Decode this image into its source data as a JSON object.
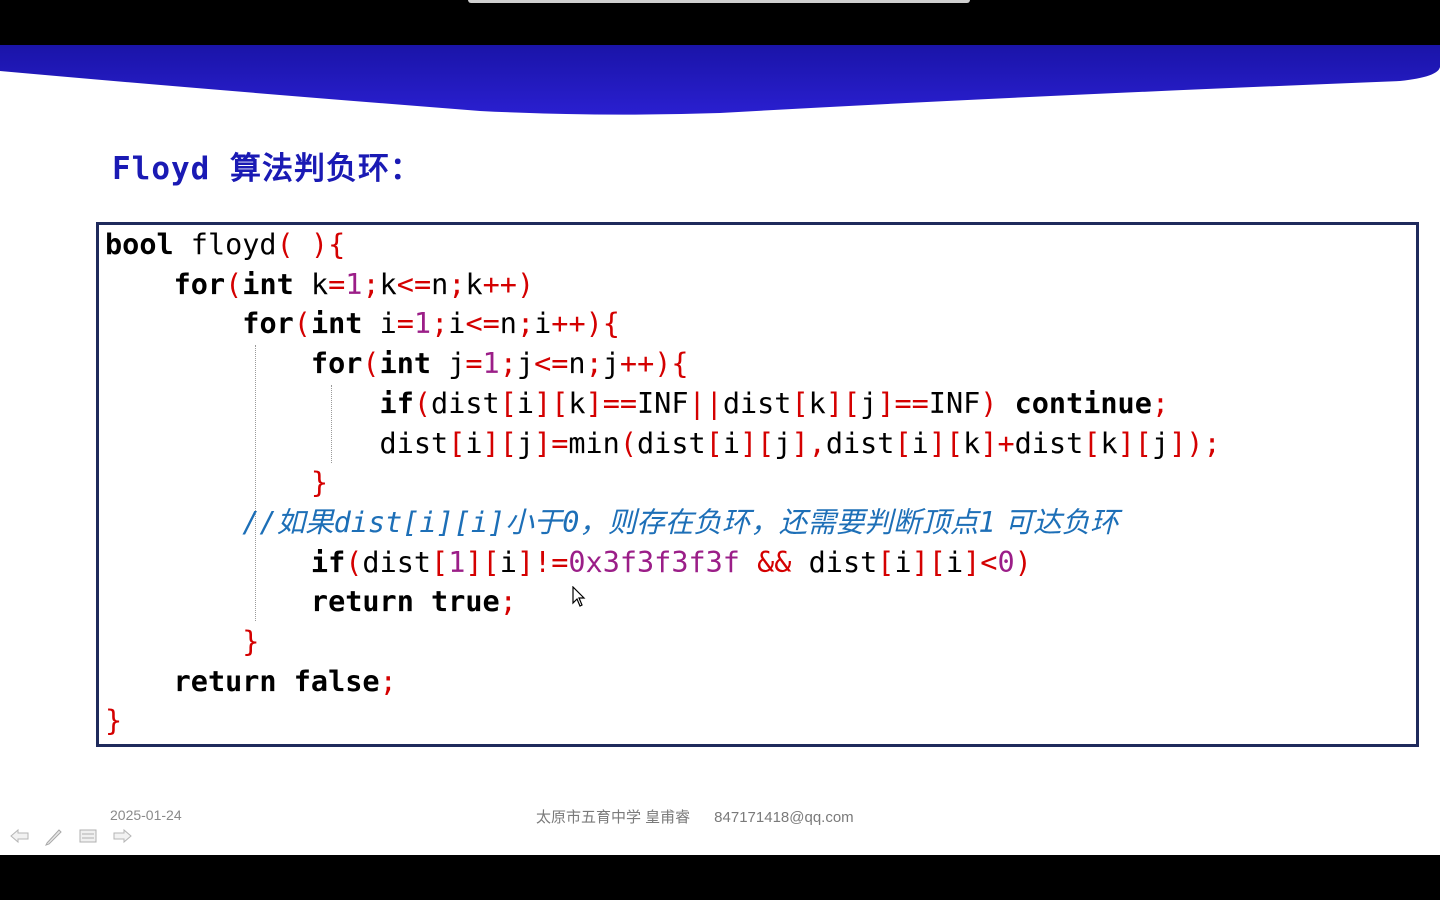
{
  "slide": {
    "title": "Floyd 算法判负环：",
    "code_lines": [
      {
        "tokens": [
          {
            "t": "bool",
            "c": "kw"
          },
          {
            "t": " floyd",
            "c": "plain"
          },
          {
            "t": "( ){",
            "c": "p"
          }
        ]
      },
      {
        "tokens": [
          {
            "t": "    ",
            "c": "plain"
          },
          {
            "t": "for",
            "c": "kw"
          },
          {
            "t": "(",
            "c": "p"
          },
          {
            "t": "int",
            "c": "kw"
          },
          {
            "t": " k",
            "c": "plain"
          },
          {
            "t": "=",
            "c": "p"
          },
          {
            "t": "1",
            "c": "n"
          },
          {
            "t": ";",
            "c": "p"
          },
          {
            "t": "k",
            "c": "plain"
          },
          {
            "t": "<=",
            "c": "p"
          },
          {
            "t": "n",
            "c": "plain"
          },
          {
            "t": ";",
            "c": "p"
          },
          {
            "t": "k",
            "c": "plain"
          },
          {
            "t": "++)",
            "c": "p"
          }
        ]
      },
      {
        "tokens": [
          {
            "t": "        ",
            "c": "plain"
          },
          {
            "t": "for",
            "c": "kw"
          },
          {
            "t": "(",
            "c": "p"
          },
          {
            "t": "int",
            "c": "kw"
          },
          {
            "t": " i",
            "c": "plain"
          },
          {
            "t": "=",
            "c": "p"
          },
          {
            "t": "1",
            "c": "n"
          },
          {
            "t": ";",
            "c": "p"
          },
          {
            "t": "i",
            "c": "plain"
          },
          {
            "t": "<=",
            "c": "p"
          },
          {
            "t": "n",
            "c": "plain"
          },
          {
            "t": ";",
            "c": "p"
          },
          {
            "t": "i",
            "c": "plain"
          },
          {
            "t": "++){",
            "c": "p"
          }
        ]
      },
      {
        "tokens": [
          {
            "t": "            ",
            "c": "plain"
          },
          {
            "t": "for",
            "c": "kw"
          },
          {
            "t": "(",
            "c": "p"
          },
          {
            "t": "int",
            "c": "kw"
          },
          {
            "t": " j",
            "c": "plain"
          },
          {
            "t": "=",
            "c": "p"
          },
          {
            "t": "1",
            "c": "n"
          },
          {
            "t": ";",
            "c": "p"
          },
          {
            "t": "j",
            "c": "plain"
          },
          {
            "t": "<=",
            "c": "p"
          },
          {
            "t": "n",
            "c": "plain"
          },
          {
            "t": ";",
            "c": "p"
          },
          {
            "t": "j",
            "c": "plain"
          },
          {
            "t": "++){",
            "c": "p"
          }
        ]
      },
      {
        "tokens": [
          {
            "t": "                ",
            "c": "plain"
          },
          {
            "t": "if",
            "c": "kw"
          },
          {
            "t": "(",
            "c": "p"
          },
          {
            "t": "dist",
            "c": "plain"
          },
          {
            "t": "[",
            "c": "p"
          },
          {
            "t": "i",
            "c": "plain"
          },
          {
            "t": "][",
            "c": "p"
          },
          {
            "t": "k",
            "c": "plain"
          },
          {
            "t": "]==",
            "c": "p"
          },
          {
            "t": "INF",
            "c": "plain"
          },
          {
            "t": "||",
            "c": "p"
          },
          {
            "t": "dist",
            "c": "plain"
          },
          {
            "t": "[",
            "c": "p"
          },
          {
            "t": "k",
            "c": "plain"
          },
          {
            "t": "][",
            "c": "p"
          },
          {
            "t": "j",
            "c": "plain"
          },
          {
            "t": "]==",
            "c": "p"
          },
          {
            "t": "INF",
            "c": "plain"
          },
          {
            "t": ") ",
            "c": "p"
          },
          {
            "t": "continue",
            "c": "kw"
          },
          {
            "t": ";",
            "c": "p"
          }
        ]
      },
      {
        "tokens": [
          {
            "t": "                ",
            "c": "plain"
          },
          {
            "t": "dist",
            "c": "plain"
          },
          {
            "t": "[",
            "c": "p"
          },
          {
            "t": "i",
            "c": "plain"
          },
          {
            "t": "][",
            "c": "p"
          },
          {
            "t": "j",
            "c": "plain"
          },
          {
            "t": "]=",
            "c": "p"
          },
          {
            "t": "min",
            "c": "plain"
          },
          {
            "t": "(",
            "c": "p"
          },
          {
            "t": "dist",
            "c": "plain"
          },
          {
            "t": "[",
            "c": "p"
          },
          {
            "t": "i",
            "c": "plain"
          },
          {
            "t": "][",
            "c": "p"
          },
          {
            "t": "j",
            "c": "plain"
          },
          {
            "t": "],",
            "c": "p"
          },
          {
            "t": "dist",
            "c": "plain"
          },
          {
            "t": "[",
            "c": "p"
          },
          {
            "t": "i",
            "c": "plain"
          },
          {
            "t": "][",
            "c": "p"
          },
          {
            "t": "k",
            "c": "plain"
          },
          {
            "t": "]+",
            "c": "p"
          },
          {
            "t": "dist",
            "c": "plain"
          },
          {
            "t": "[",
            "c": "p"
          },
          {
            "t": "k",
            "c": "plain"
          },
          {
            "t": "][",
            "c": "p"
          },
          {
            "t": "j",
            "c": "plain"
          },
          {
            "t": "]);",
            "c": "p"
          }
        ]
      },
      {
        "tokens": [
          {
            "t": "            ",
            "c": "plain"
          },
          {
            "t": "}",
            "c": "p"
          }
        ]
      },
      {
        "tokens": [
          {
            "t": "        ",
            "c": "plain"
          },
          {
            "t": "//",
            "c": "cm-code"
          },
          {
            "t": "如果",
            "c": "cm"
          },
          {
            "t": "dist[i][i]",
            "c": "cm-code"
          },
          {
            "t": "小于",
            "c": "cm"
          },
          {
            "t": "0",
            "c": "cm-code"
          },
          {
            "t": "，则存在负环，还需要判断顶点",
            "c": "cm"
          },
          {
            "t": "1",
            "c": "cm-code"
          },
          {
            "t": " 可达负环",
            "c": "cm"
          }
        ]
      },
      {
        "tokens": [
          {
            "t": "            ",
            "c": "plain"
          },
          {
            "t": "if",
            "c": "kw"
          },
          {
            "t": "(",
            "c": "p"
          },
          {
            "t": "dist",
            "c": "plain"
          },
          {
            "t": "[",
            "c": "p"
          },
          {
            "t": "1",
            "c": "n"
          },
          {
            "t": "][",
            "c": "p"
          },
          {
            "t": "i",
            "c": "plain"
          },
          {
            "t": "]!=",
            "c": "p"
          },
          {
            "t": "0x3f3f3f3f",
            "c": "n"
          },
          {
            "t": " ",
            "c": "plain"
          },
          {
            "t": "&&",
            "c": "p"
          },
          {
            "t": " dist",
            "c": "plain"
          },
          {
            "t": "[",
            "c": "p"
          },
          {
            "t": "i",
            "c": "plain"
          },
          {
            "t": "][",
            "c": "p"
          },
          {
            "t": "i",
            "c": "plain"
          },
          {
            "t": "]<",
            "c": "p"
          },
          {
            "t": "0",
            "c": "n"
          },
          {
            "t": ")",
            "c": "p"
          }
        ]
      },
      {
        "tokens": [
          {
            "t": "            ",
            "c": "plain"
          },
          {
            "t": "return",
            "c": "kw"
          },
          {
            "t": " ",
            "c": "plain"
          },
          {
            "t": "true",
            "c": "kw"
          },
          {
            "t": ";",
            "c": "p"
          }
        ]
      },
      {
        "tokens": [
          {
            "t": "        ",
            "c": "plain"
          },
          {
            "t": "}",
            "c": "p"
          }
        ]
      },
      {
        "tokens": [
          {
            "t": "    ",
            "c": "plain"
          },
          {
            "t": "return",
            "c": "kw"
          },
          {
            "t": " ",
            "c": "plain"
          },
          {
            "t": "false",
            "c": "kw"
          },
          {
            "t": ";",
            "c": "p"
          }
        ]
      },
      {
        "tokens": [
          {
            "t": "}",
            "c": "p"
          }
        ]
      }
    ],
    "footer": {
      "date": "2025-01-24",
      "author": "太原市五育中学 皇甫睿",
      "email": "847171418@qq.com"
    }
  },
  "controls": [
    {
      "name": "previous-slide-arrow-icon",
      "glyph": "⇦"
    },
    {
      "name": "pen-icon",
      "glyph": "／"
    },
    {
      "name": "slide-menu-icon",
      "glyph": "▭"
    },
    {
      "name": "next-slide-arrow-icon",
      "glyph": "⇨"
    }
  ],
  "colors": {
    "title": "#1a1ab4",
    "banner": "#1f18b9",
    "punctuation": "#d40000",
    "number": "#9b1e88",
    "comment": "#1d6fb7",
    "box_border": "#1f2a5c"
  }
}
